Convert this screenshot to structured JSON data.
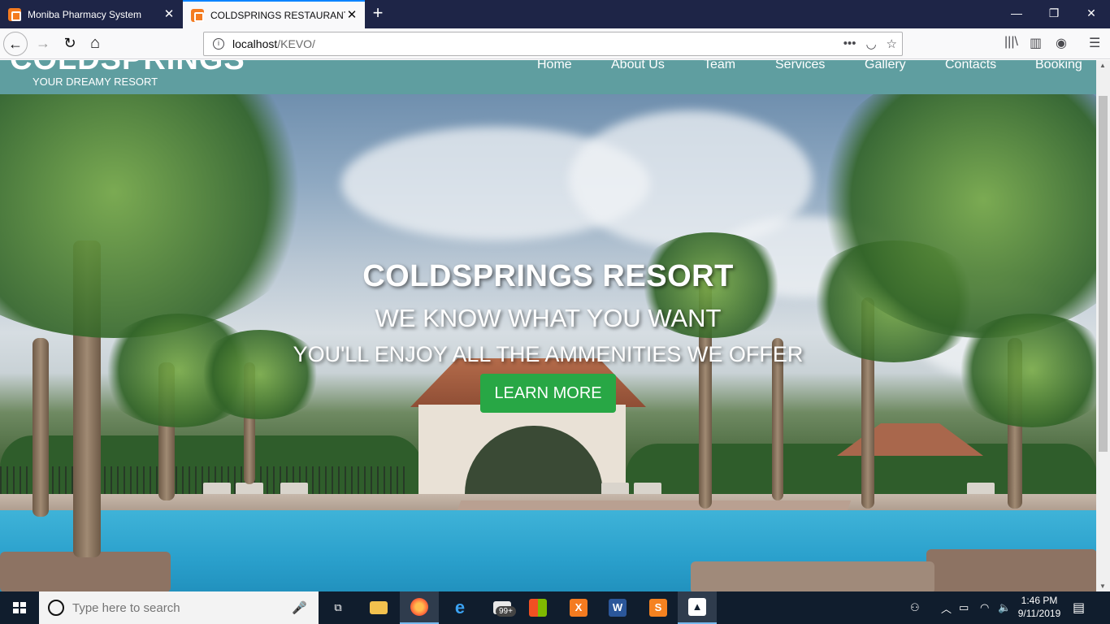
{
  "browser": {
    "tabs": [
      {
        "title": "Moniba Pharmacy System",
        "active": false
      },
      {
        "title": "COLDSPRINGS RESTAURANT",
        "active": true
      }
    ],
    "new_tab_icon": "+",
    "window_controls": {
      "minimize": "—",
      "restore": "❐",
      "close": "✕"
    },
    "url": {
      "host": "localhost",
      "path": "/KEVO/"
    },
    "nav": {
      "back": "←",
      "forward": "→",
      "reload": "↻",
      "home": "⌂"
    },
    "url_icons": {
      "more": "•••",
      "pocket": "◡",
      "bookmark": "☆"
    },
    "toolbar_icons": {
      "library": "|||\\",
      "sidebar": "▥",
      "account": "◉",
      "menu": "☰"
    }
  },
  "site": {
    "logo": "COLDSPRINGS",
    "tagline": "YOUR DREAMY RESORT",
    "menu": [
      "Home",
      "About Us",
      "Team",
      "Services",
      "Gallery",
      "Contacts",
      "Booking"
    ],
    "header_color": "#5f9ea0",
    "hero": {
      "title": "COLDSPRINGS RESORT",
      "subtitle": "WE KNOW WHAT YOU WANT",
      "subtitle2": "YOU'LL ENJOY ALL THE AMMENITIES WE OFFER",
      "cta": "LEARN MORE",
      "cta_color": "#28a745"
    }
  },
  "taskbar": {
    "search_placeholder": "Type here to search",
    "badge": "99+",
    "time": "1:46 PM",
    "date": "9/11/2019",
    "apps": [
      "task-view",
      "file-explorer",
      "firefox",
      "edge",
      "mail",
      "store",
      "xampp",
      "word",
      "sublime",
      "photos"
    ]
  }
}
